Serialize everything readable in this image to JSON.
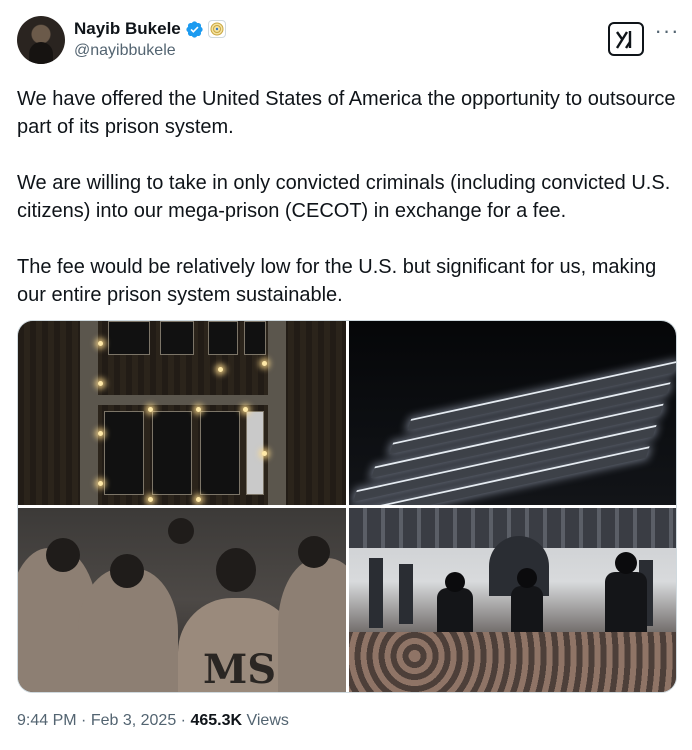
{
  "author": {
    "name": "Nayib Bukele",
    "handle": "@nayibbukele",
    "verified_icon": "verified-badge-icon",
    "affiliation_icon": "government-seal-icon"
  },
  "actions": {
    "grok_icon": "grok-icon",
    "more_label": "···"
  },
  "tweet": {
    "paragraphs": [
      "We have offered the United States of America the opportunity to outsource part of its prison system.",
      "We are willing to take in only convicted criminals (including convicted U.S. citizens) into our mega-prison (CECOT) in exchange for a fee.",
      "The fee would be relatively low for the U.S. but significant for us, making our entire prison system sustainable."
    ]
  },
  "media": {
    "photos": [
      "aerial-night-prison-photo",
      "oblique-night-prison-photo",
      "inmates-closeup-photo",
      "prison-hall-guards-photo"
    ]
  },
  "meta": {
    "time": "9:44 PM",
    "sep1": " · ",
    "date": "Feb 3, 2025",
    "sep2": " · ",
    "views_count": "465.3K",
    "views_label": " Views"
  },
  "colors": {
    "text": "#0f1419",
    "secondary": "#536471",
    "verified_blue": "#1d9bf0",
    "border": "#cfd9de"
  }
}
